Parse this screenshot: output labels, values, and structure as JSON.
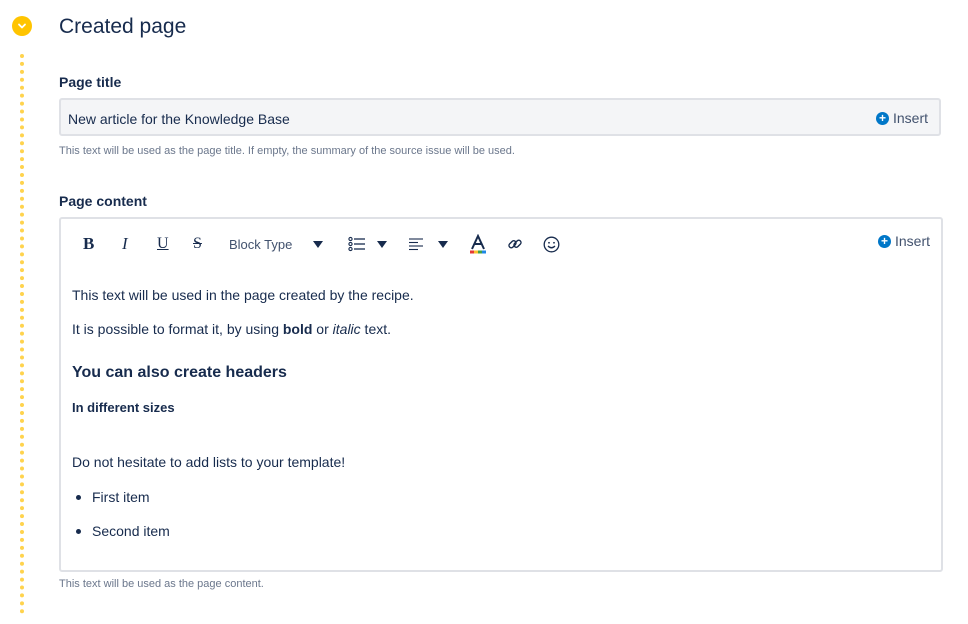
{
  "section": {
    "title": "Created page"
  },
  "page_title": {
    "label": "Page title",
    "value": "New article for the Knowledge Base",
    "insert_label": "Insert",
    "help": "This text will be used as the page title. If empty, the summary of the source issue will be used."
  },
  "page_content": {
    "label": "Page content",
    "insert_label": "Insert",
    "help": "This text will be used as the page content.",
    "toolbar": {
      "bold": "B",
      "italic": "I",
      "underline": "U",
      "strike": "S",
      "block_type": "Block Type"
    },
    "body": {
      "p1": "This text will be used in the page created by the recipe.",
      "p2_prefix": "It is possible to format it, by using ",
      "p2_bold": "bold",
      "p2_mid": " or ",
      "p2_italic": "italic",
      "p2_suffix": " text.",
      "h1": "You can also create headers",
      "h2": "In different sizes",
      "p3": "Do not hesitate to add lists to your template!",
      "list": [
        "First item",
        "Second item"
      ]
    }
  },
  "colors": {
    "accent": "#ffc400",
    "insert": "#0077c8",
    "text": "#172b4d",
    "help": "#6b778c"
  }
}
